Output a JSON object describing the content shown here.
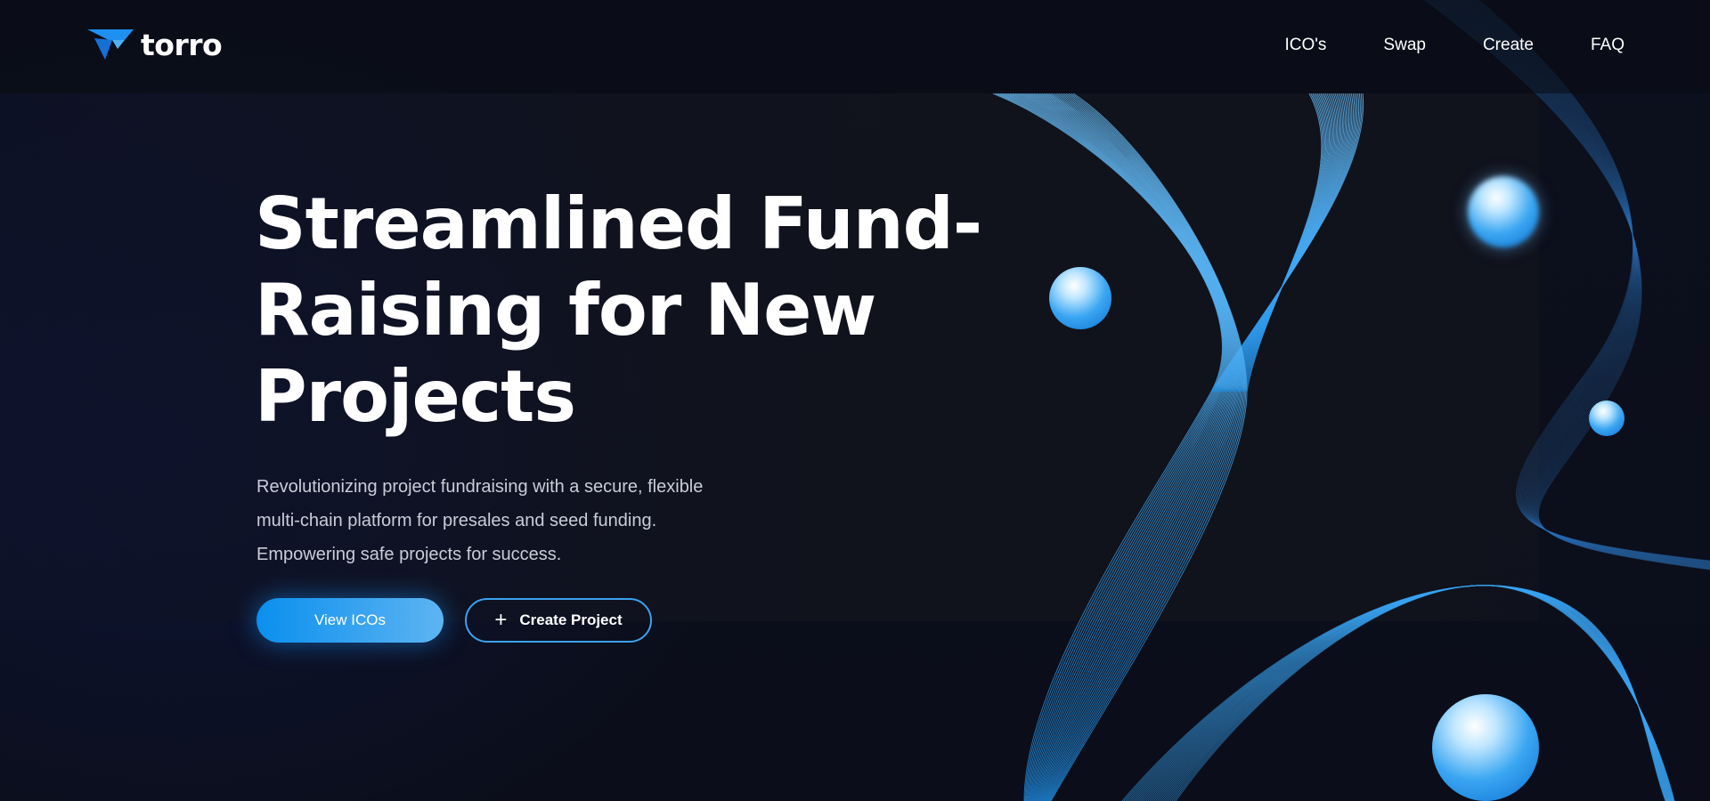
{
  "brand": {
    "name": "torro",
    "accent": "#1e90f0"
  },
  "nav": {
    "items": [
      {
        "label": "ICO's"
      },
      {
        "label": "Swap"
      },
      {
        "label": "Create"
      },
      {
        "label": "FAQ"
      }
    ]
  },
  "hero": {
    "headline_line1": "Streamlined Fund-",
    "headline_line2": "Raising for New",
    "headline_line3": "Projects",
    "sub_line1": "Revolutionizing project fundraising with a secure, flexible",
    "sub_line2": "multi-chain platform for presales and seed funding.",
    "sub_line3": "Empowering safe projects for success.",
    "primary_button": "View ICOs",
    "secondary_button": "Create Project",
    "secondary_icon": "plus-icon"
  }
}
